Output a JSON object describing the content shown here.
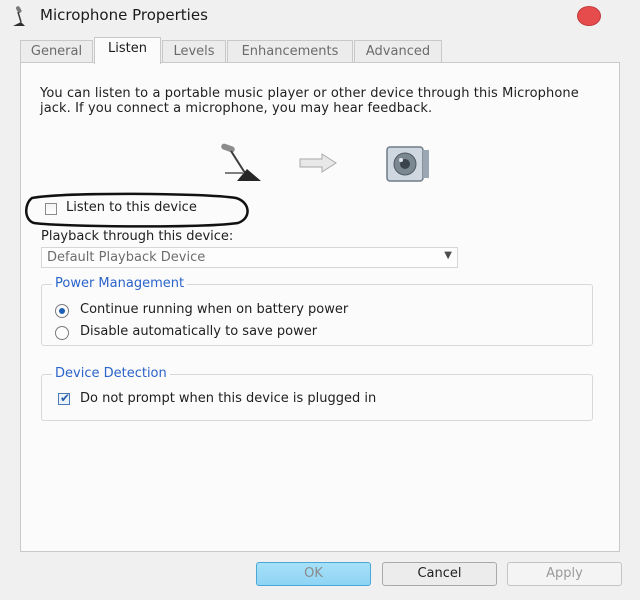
{
  "window": {
    "title": "Microphone Properties",
    "close_color": "#e74c4c"
  },
  "tabs": [
    {
      "label": "General",
      "active": false
    },
    {
      "label": "Listen",
      "active": true
    },
    {
      "label": "Levels",
      "active": false
    },
    {
      "label": "Enhancements",
      "active": false
    },
    {
      "label": "Advanced",
      "active": false
    }
  ],
  "listen": {
    "description": "You can listen to a portable music player or other device through this Microphone jack.  If you connect a microphone, you may hear feedback.",
    "listen_checkbox_label": "Listen to this device",
    "listen_checked": false,
    "playback_label": "Playback through this device:",
    "playback_value": "Default Playback Device"
  },
  "power_management": {
    "title": "Power Management",
    "options": [
      {
        "label": "Continue running when on battery power",
        "selected": true
      },
      {
        "label": "Disable automatically to save power",
        "selected": false
      }
    ]
  },
  "device_detection": {
    "title": "Device Detection",
    "prompt_label": "Do not prompt when this device is plugged in",
    "prompt_checked": true
  },
  "buttons": {
    "ok": "OK",
    "cancel": "Cancel",
    "apply": "Apply"
  },
  "icons": [
    "microphone-icon",
    "arrow-right-icon",
    "speaker-icon"
  ],
  "colors": {
    "accent_blue": "#2a63c9",
    "ok_button": "#8fd3f4"
  }
}
